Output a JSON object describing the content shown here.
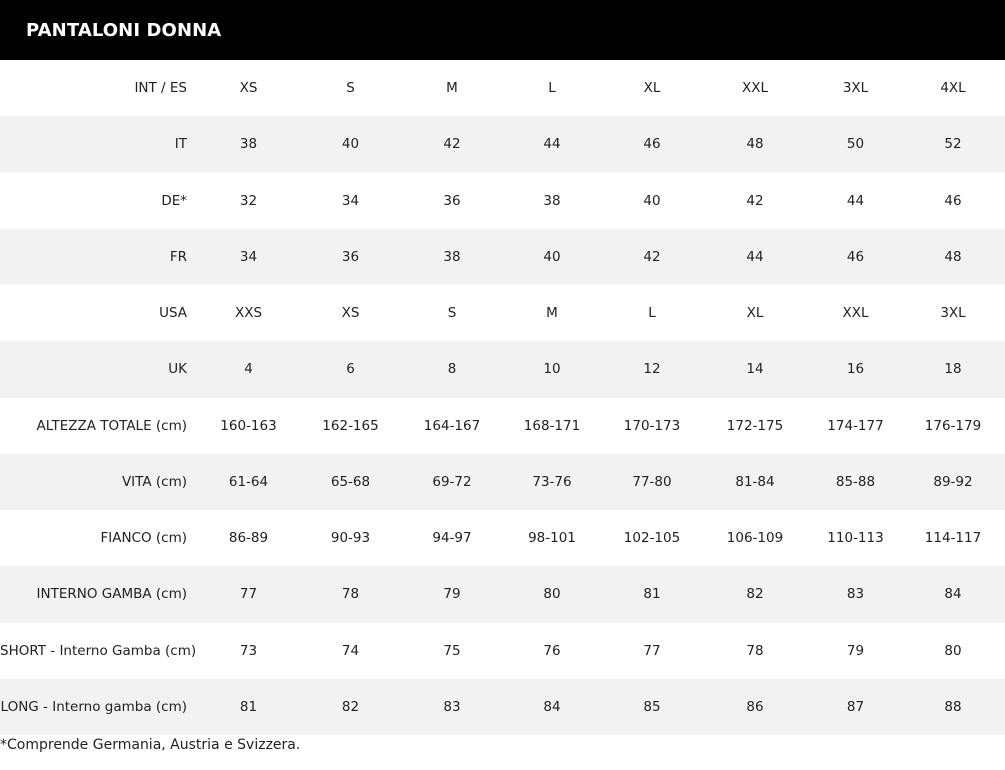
{
  "title": "PANTALONI DONNA",
  "rows": [
    {
      "label": "INT / ES",
      "values": [
        "XS",
        "S",
        "M",
        "L",
        "XL",
        "XXL",
        "3XL",
        "4XL"
      ]
    },
    {
      "label": "IT",
      "values": [
        "38",
        "40",
        "42",
        "44",
        "46",
        "48",
        "50",
        "52"
      ]
    },
    {
      "label": "DE*",
      "values": [
        "32",
        "34",
        "36",
        "38",
        "40",
        "42",
        "44",
        "46"
      ]
    },
    {
      "label": "FR",
      "values": [
        "34",
        "36",
        "38",
        "40",
        "42",
        "44",
        "46",
        "48"
      ]
    },
    {
      "label": "USA",
      "values": [
        "XXS",
        "XS",
        "S",
        "M",
        "L",
        "XL",
        "XXL",
        "3XL"
      ]
    },
    {
      "label": "UK",
      "values": [
        "4",
        "6",
        "8",
        "10",
        "12",
        "14",
        "16",
        "18"
      ]
    },
    {
      "label": "ALTEZZA TOTALE (cm)",
      "values": [
        "160-163",
        "162-165",
        "164-167",
        "168-171",
        "170-173",
        "172-175",
        "174-177",
        "176-179"
      ]
    },
    {
      "label": "VITA (cm)",
      "values": [
        "61-64",
        "65-68",
        "69-72",
        "73-76",
        "77-80",
        "81-84",
        "85-88",
        "89-92"
      ]
    },
    {
      "label": "FIANCO (cm)",
      "values": [
        "86-89",
        "90-93",
        "94-97",
        "98-101",
        "102-105",
        "106-109",
        "110-113",
        "114-117"
      ]
    },
    {
      "label": "INTERNO GAMBA (cm)",
      "values": [
        "77",
        "78",
        "79",
        "80",
        "81",
        "82",
        "83",
        "84"
      ]
    },
    {
      "label": "SHORT - Interno Gamba (cm)",
      "values": [
        "73",
        "74",
        "75",
        "76",
        "77",
        "78",
        "79",
        "80"
      ]
    },
    {
      "label": "LONG - Interno gamba (cm)",
      "values": [
        "81",
        "82",
        "83",
        "84",
        "85",
        "86",
        "87",
        "88"
      ]
    }
  ],
  "footnote": "*Comprende Germania, Austria e Svizzera.",
  "colors": {
    "header_bg": "#000000",
    "header_text": "#ffffff",
    "stripe": "#f2f2f2",
    "text": "#222222"
  }
}
